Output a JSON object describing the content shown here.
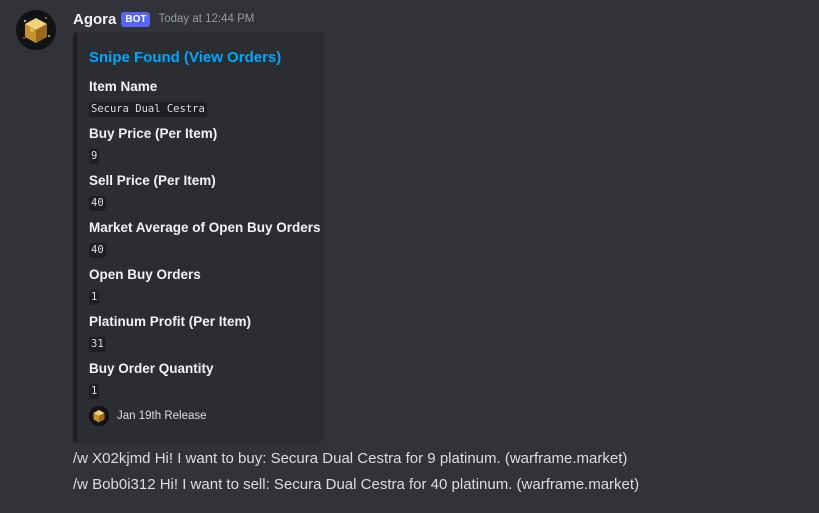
{
  "author": {
    "name": "Agora",
    "bot_tag": "BOT",
    "timestamp": "Today at 12:44 PM",
    "avatar_icon": "golden-cube-icon"
  },
  "embed": {
    "title": "Snipe Found (View Orders)",
    "fields": [
      {
        "name": "Item Name",
        "value": "Secura Dual Cestra"
      },
      {
        "name": "Buy Price (Per Item)",
        "value": "9"
      },
      {
        "name": "Sell Price (Per Item)",
        "value": "40"
      },
      {
        "name": "Market Average of Open Buy Orders",
        "value": "40"
      },
      {
        "name": "Open Buy Orders",
        "value": "1"
      },
      {
        "name": "Platinum Profit (Per Item)",
        "value": "31"
      },
      {
        "name": "Buy Order Quantity",
        "value": "1"
      }
    ],
    "footer": {
      "text": "Jan 19th Release",
      "icon": "golden-cube-icon"
    }
  },
  "messages": [
    "/w X02kjmd Hi! I want to buy: Secura Dual Cestra for 9 platinum. (warframe.market)",
    "/w Bob0i312 Hi! I want to sell: Secura Dual Cestra for 40 platinum. (warframe.market)"
  ],
  "colors": {
    "background": "#313338",
    "embed_background": "#2b2d31",
    "link": "#00a8fc",
    "bot_tag": "#5865f2",
    "cube_gold": "#d9a83a"
  }
}
